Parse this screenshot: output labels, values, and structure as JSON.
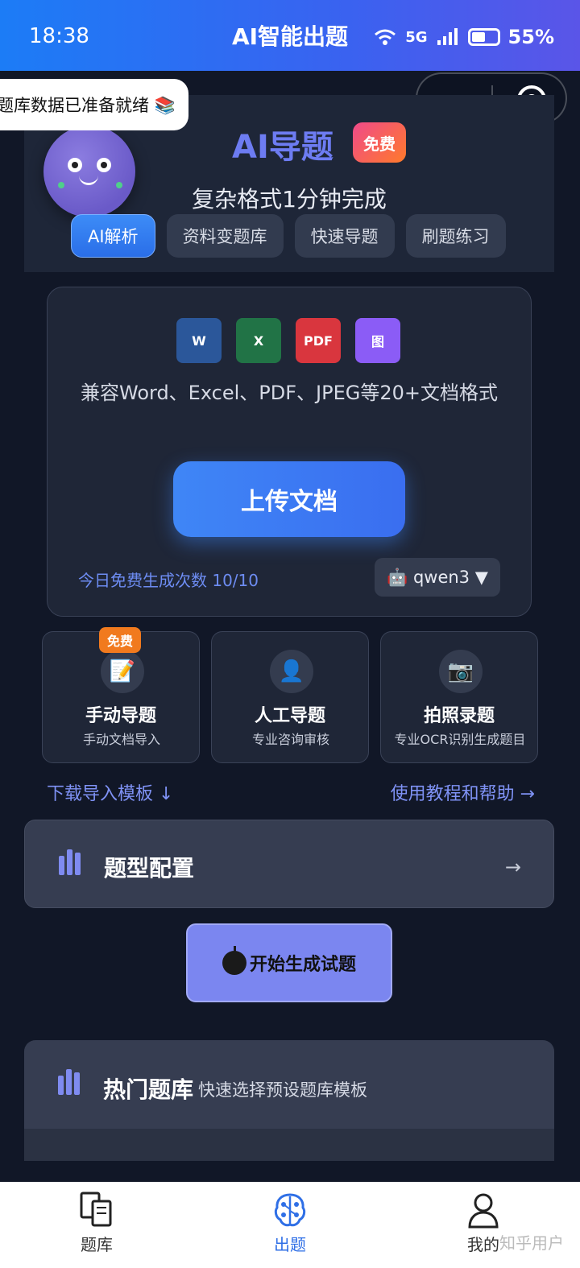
{
  "status_bar": {
    "time": "18:38",
    "network": "5G",
    "battery": "55%"
  },
  "app": {
    "title": "AI智能出题"
  },
  "toast": {
    "text": "题库数据已准备就绪 📚"
  },
  "hero": {
    "title": "AI导题",
    "badge": "免费",
    "subtitle": "复杂格式1分钟完成",
    "tabs": [
      {
        "label": "AI解析",
        "active": true
      },
      {
        "label": "资料变题库",
        "active": false
      },
      {
        "label": "快速导题",
        "active": false
      },
      {
        "label": "刷题练习",
        "active": false
      }
    ]
  },
  "upload": {
    "formats": [
      {
        "label": "W",
        "color": "#2b579a"
      },
      {
        "label": "X",
        "color": "#217346"
      },
      {
        "label": "PDF",
        "color": "#d9363e"
      },
      {
        "label": "图",
        "color": "#8b5cf6"
      }
    ],
    "description": "兼容Word、Excel、PDF、JPEG等20+文档格式",
    "button": "上传文档",
    "free_count": "今日免费生成次数 10/10",
    "model": "🤖 qwen3 ▼"
  },
  "features": [
    {
      "icon": "📝",
      "icon_name": "memo-icon",
      "title": "手动导题",
      "subtitle": "手动文档导入",
      "tag": "免费"
    },
    {
      "icon": "👤",
      "icon_name": "person-icon",
      "title": "人工导题",
      "subtitle": "专业咨询审核",
      "tag": ""
    },
    {
      "icon": "📷",
      "icon_name": "camera-icon",
      "title": "拍照录题",
      "subtitle": "专业OCR识别生成题目",
      "tag": ""
    }
  ],
  "links": {
    "template": "下载导入模板 ↓",
    "help": "使用教程和帮助 →"
  },
  "config": {
    "title": "题型配置",
    "arrow": "→"
  },
  "generate": {
    "label": "开始生成试题"
  },
  "hot": {
    "title": "热门题库",
    "subtitle": "快速选择预设题库模板"
  },
  "nav": [
    {
      "label": "题库",
      "active": false
    },
    {
      "label": "出题",
      "active": true
    },
    {
      "label": "我的",
      "active": false
    }
  ],
  "watermark": "知乎用户"
}
